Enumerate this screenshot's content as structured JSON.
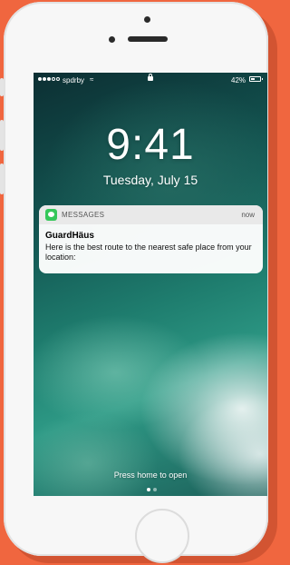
{
  "status_bar": {
    "signal_bars_filled": 3,
    "signal_bars_total": 5,
    "carrier": "spdrby",
    "wifi_icon": "wifi-icon",
    "lock_icon": "lock-icon",
    "battery_percent_label": "42%",
    "battery_level": 0.42
  },
  "lock_screen": {
    "time": "9:41",
    "date": "Tuesday, July 15",
    "hint": "Press home to open",
    "page_indicator": {
      "pages": 2,
      "active": 0
    }
  },
  "notification": {
    "app_icon": "messages-icon",
    "app_name": "MESSAGES",
    "time": "now",
    "sender": "GuardHäus",
    "body": "Here is the best route to the nearest safe place from your location:"
  },
  "colors": {
    "background": "#f0663f",
    "device": "#f7f7f7",
    "messages_green": "#34c759"
  }
}
